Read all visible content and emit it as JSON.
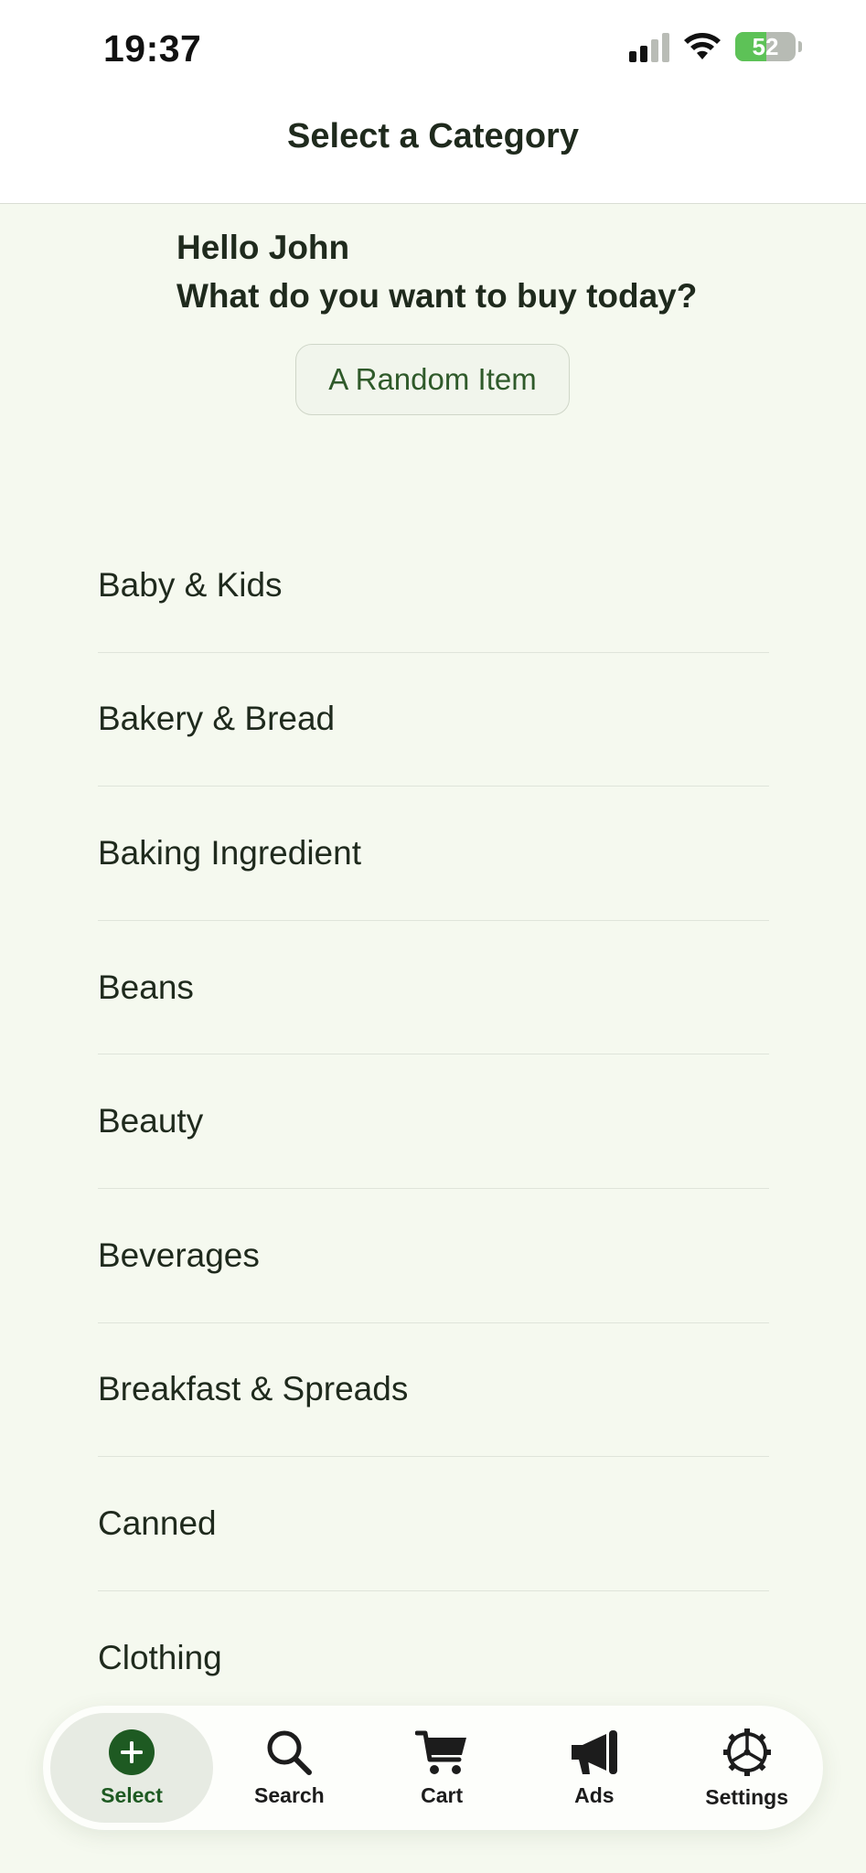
{
  "status_bar": {
    "time": "19:37",
    "battery": "52"
  },
  "header": {
    "title": "Select a Category"
  },
  "greeting": {
    "line1": "Hello John",
    "line2": "What do you want to buy today?"
  },
  "random_button": {
    "label": "A Random Item"
  },
  "categories": [
    "Baby & Kids",
    "Bakery & Bread",
    "Baking Ingredient",
    "Beans",
    "Beauty",
    "Beverages",
    "Breakfast & Spreads",
    "Canned",
    "Clothing"
  ],
  "tabbar": {
    "tabs": [
      {
        "label": "Select",
        "icon": "plus-circle-icon",
        "active": true
      },
      {
        "label": "Search",
        "icon": "magnifier-icon",
        "active": false
      },
      {
        "label": "Cart",
        "icon": "cart-icon",
        "active": false
      },
      {
        "label": "Ads",
        "icon": "megaphone-icon",
        "active": false
      },
      {
        "label": "Settings",
        "icon": "gear-icon",
        "active": false
      }
    ]
  },
  "colors": {
    "accent": "#1e5a22",
    "background": "#f5f9ef",
    "battery_green": "#5dc257"
  }
}
